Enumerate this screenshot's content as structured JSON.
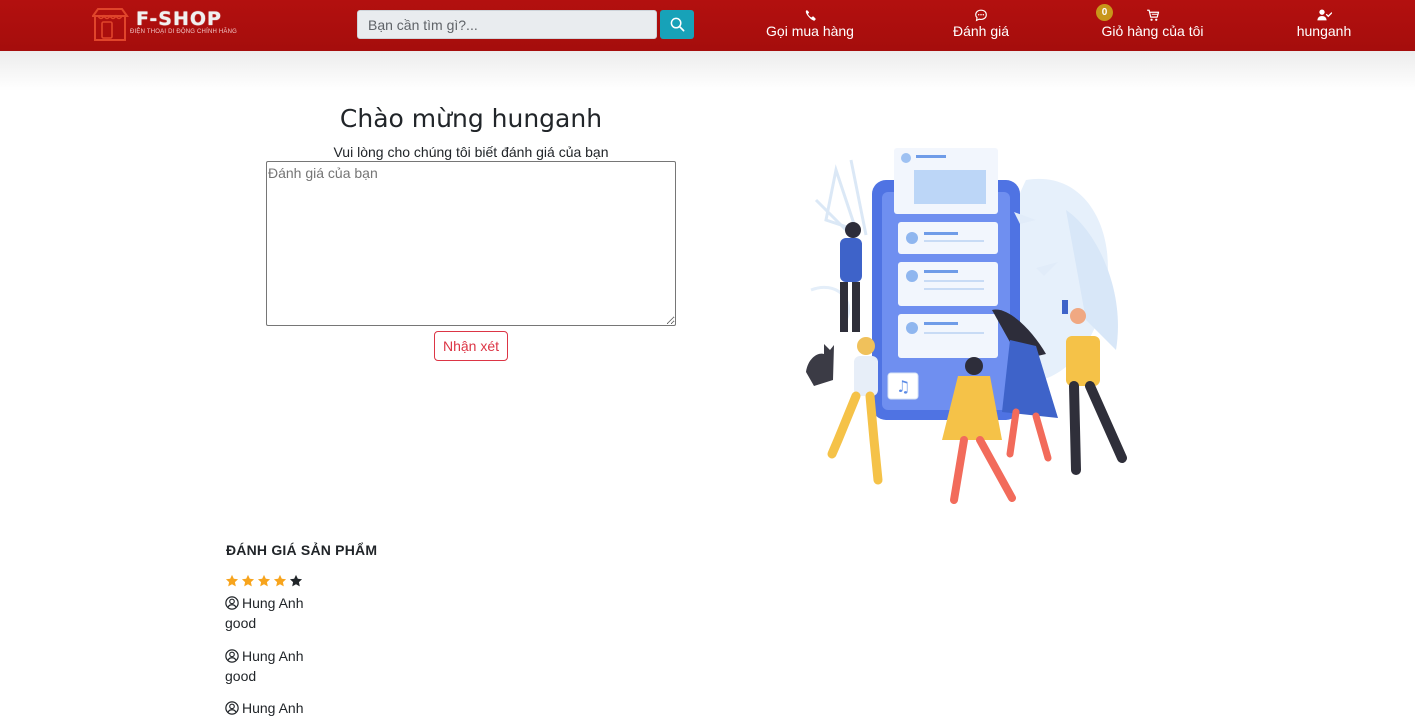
{
  "header": {
    "brand": "F-SHOP",
    "tagline": "ĐIỆN THOẠI DI ĐỘNG CHÍNH HÃNG",
    "search_placeholder": "Bạn cần tìm gì?...",
    "nav": {
      "call": "Gọi mua hàng",
      "review": "Đánh giá",
      "cart": "Giỏ hàng của tôi",
      "cart_count": "0",
      "user": "hunganh"
    },
    "colors": {
      "bar": "#b3100f",
      "search_button": "#17a2b8",
      "badge": "#c8961a"
    },
    "icons": [
      "shop-logo-icon",
      "search-icon",
      "phone-icon",
      "chat-icon",
      "cart-icon",
      "user-check-icon"
    ]
  },
  "main": {
    "welcome": "Chào mừng hunganh",
    "subtitle": "Vui lòng cho chúng tôi biết đánh giá của bạn",
    "textarea_placeholder": "Đánh giá của bạn",
    "textarea_value": "",
    "submit_label": "Nhận xét",
    "illustration": "people-social-feed-illustration"
  },
  "reviews": {
    "title": "ĐÁNH GIÁ SẢN PHẨM",
    "rating": 4,
    "rating_max": 5,
    "items": [
      {
        "author": "Hung Anh",
        "comment": "good"
      },
      {
        "author": "Hung Anh",
        "comment": "good"
      },
      {
        "author": "Hung Anh",
        "comment": ""
      }
    ]
  }
}
